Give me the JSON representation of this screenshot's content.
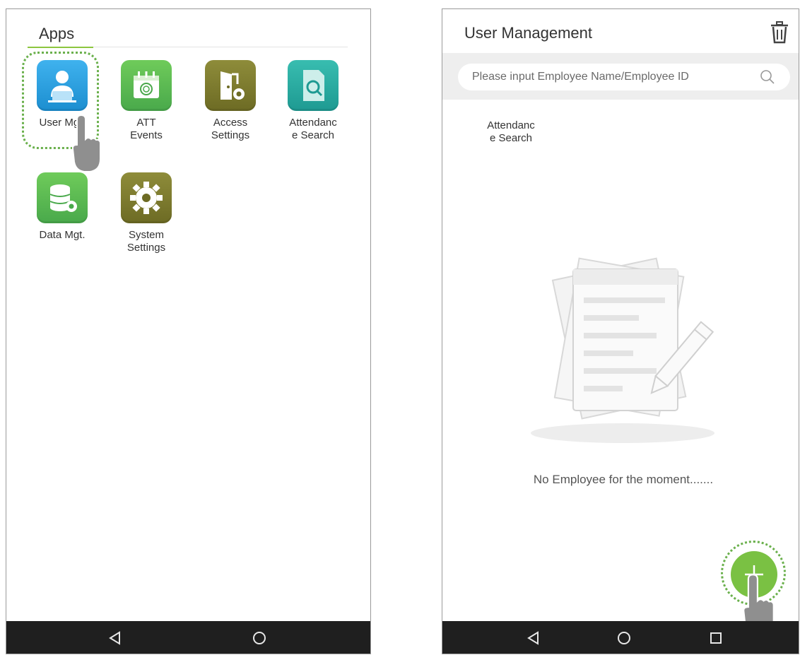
{
  "left_screen": {
    "section_title": "Apps",
    "apps": [
      {
        "label": "User Mgt.",
        "icon": "user-management-icon",
        "color": "#2a9ad8"
      },
      {
        "label": "ATT\nEvents",
        "icon": "attendance-events-icon",
        "color": "#5cb85c"
      },
      {
        "label": "Access\nSettings",
        "icon": "access-settings-icon",
        "color": "#7e7d2e"
      },
      {
        "label": "Attendanc\ne Search",
        "icon": "attendance-search-icon",
        "color": "#27a9a0"
      },
      {
        "label": "Data Mgt.",
        "icon": "data-management-icon",
        "color": "#5cb85c"
      },
      {
        "label": "System\nSettings",
        "icon": "system-settings-icon",
        "color": "#7e7d2e"
      }
    ],
    "navbar": [
      "back-icon",
      "home-icon"
    ]
  },
  "right_screen": {
    "title": "User Management",
    "trash_icon": "trash-icon",
    "search": {
      "placeholder": "Please input Employee Name/Employee ID"
    },
    "stray_label": "Attendanc\ne Search",
    "empty_message": "No Employee for the moment.......",
    "fab_icon": "plus-icon",
    "navbar": [
      "back-icon",
      "home-icon",
      "recent-apps-icon"
    ]
  },
  "colors": {
    "accent_green": "#7ac143",
    "highlight_dotted": "#6ab04c",
    "navbar": "#1f1f1f"
  }
}
